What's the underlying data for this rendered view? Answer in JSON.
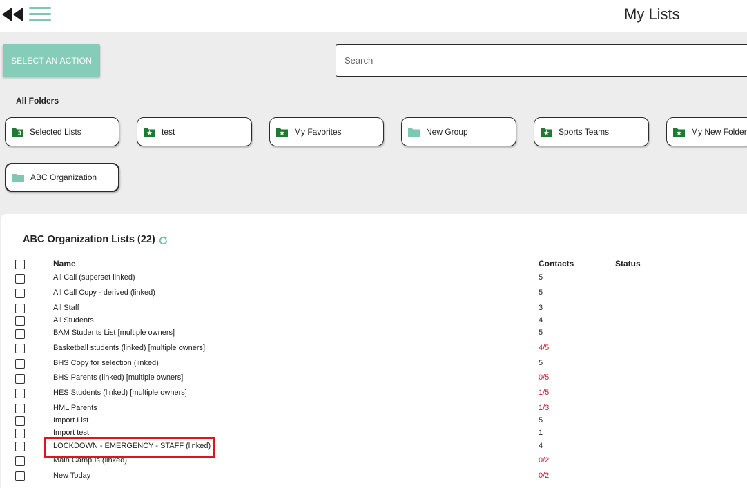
{
  "header": {
    "title": "My Lists"
  },
  "toolbar": {
    "action_label": "SELECT AN ACTION",
    "search_placeholder": "Search"
  },
  "folders": {
    "heading": "All Folders",
    "items": [
      {
        "label": "Selected Lists",
        "icon": "selected-folder-icon"
      },
      {
        "label": "test",
        "icon": "star-folder-icon"
      },
      {
        "label": "My Favorites",
        "icon": "star-folder-icon"
      },
      {
        "label": "New Group",
        "icon": "folder-icon"
      },
      {
        "label": "Sports Teams",
        "icon": "star-folder-icon"
      },
      {
        "label": "My New Folder",
        "icon": "star-folder-icon"
      },
      {
        "label": "ABC Organization",
        "icon": "folder-icon"
      }
    ]
  },
  "lists": {
    "title": "ABC Organization Lists (22)",
    "columns": {
      "name": "Name",
      "contacts": "Contacts",
      "status": "Status"
    },
    "rows": [
      {
        "name": "All Call (superset linked)",
        "contacts": "5"
      },
      {
        "name": "All Call Copy - derived (linked)",
        "contacts": "5"
      },
      {
        "name": "All Staff",
        "contacts": "3"
      },
      {
        "name": "All Students",
        "contacts": "4"
      },
      {
        "name": "BAM Students List [multiple owners]",
        "contacts": "5"
      },
      {
        "name": "Basketball students (linked) [multiple owners]",
        "contacts": "4/5"
      },
      {
        "name": "BHS Copy for selection (linked)",
        "contacts": "5"
      },
      {
        "name": "BHS Parents (linked) [multiple owners]",
        "contacts": "0/5"
      },
      {
        "name": "HES Students (linked) [multiple owners]",
        "contacts": "1/5"
      },
      {
        "name": "HML Parents",
        "contacts": "1/3"
      },
      {
        "name": "Import List",
        "contacts": "5"
      },
      {
        "name": "Import test",
        "contacts": "1"
      },
      {
        "name": "LOCKDOWN - EMERGENCY - STAFF (linked)",
        "contacts": "4"
      },
      {
        "name": "Main Campus (linked)",
        "contacts": "0/2"
      },
      {
        "name": "New Today",
        "contacts": "0/2"
      }
    ]
  },
  "colors": {
    "accent": "#86cdb9",
    "folder_green": "#1e7a32",
    "folder_teal": "#7ec8b3",
    "partial_contacts": "#c0203a",
    "highlight": "#e0141e"
  }
}
